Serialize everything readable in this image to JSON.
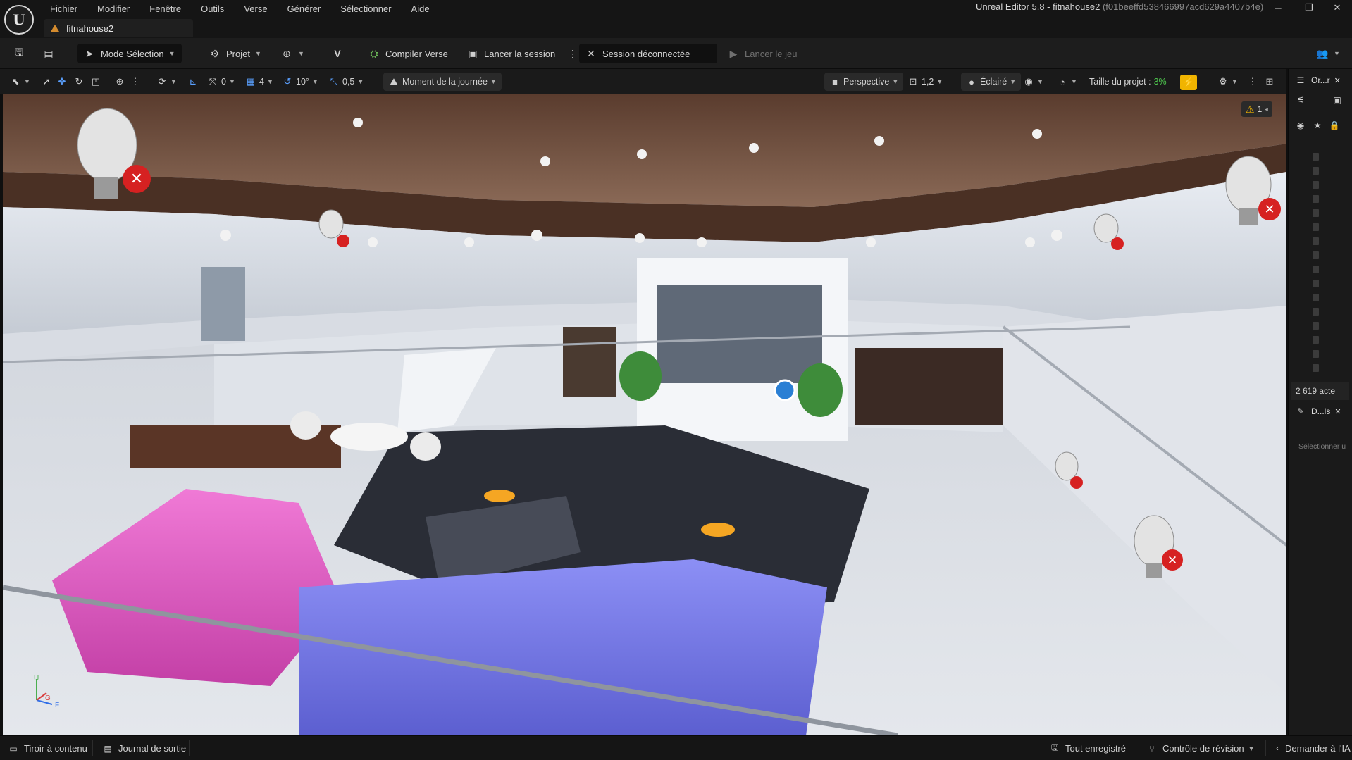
{
  "app": {
    "logo_text": "U",
    "window_title": "Unreal Editor 5.8 - fitnahouse2",
    "window_hash": "(f01beeffd538466997acd629a4407b4e)",
    "project_tab": "fitnahouse2",
    "window_controls": {
      "minimize": "─",
      "restore": "❐",
      "close": "✕"
    }
  },
  "menu": [
    "Fichier",
    "Modifier",
    "Fenêtre",
    "Outils",
    "Verse",
    "Générer",
    "Sélectionner",
    "Aide"
  ],
  "toolbar": {
    "mode": "Mode Sélection",
    "project": "Projet",
    "compile": "Compiler Verse",
    "launch_session": "Lancer la session",
    "session_status": "Session déconnectée",
    "launch_game": "Lancer le jeu"
  },
  "viewport_toolbar": {
    "rotation_snap": "0",
    "angle_snap": "10°",
    "grid_snap": "4",
    "scale_snap": "0,5",
    "time_of_day": "Moment de la journée",
    "perspective": "Perspective",
    "camera_speed": "1,2",
    "lighting": "Éclairé",
    "project_size_label": "Taille du projet :",
    "project_size_value": "3%"
  },
  "viewport": {
    "warning_count": "1",
    "axis_labels": {
      "z": "U",
      "y": "G",
      "x": "F"
    }
  },
  "right_panel": {
    "outliner_tab": "Or...r",
    "actor_count": "2 619 acte",
    "details_tab": "D...ls",
    "details_hint": "Sélectionner u"
  },
  "statusbar": {
    "content_drawer": "Tiroir à contenu",
    "output_log": "Journal de sortie",
    "all_saved": "Tout enregistré",
    "revision_control": "Contrôle de révision",
    "ask_ai": "Demander à l'IA"
  },
  "colors": {
    "accent_warning": "#f0b400",
    "project_size_green": "#4cc24c",
    "light_error_red": "#d62121"
  }
}
